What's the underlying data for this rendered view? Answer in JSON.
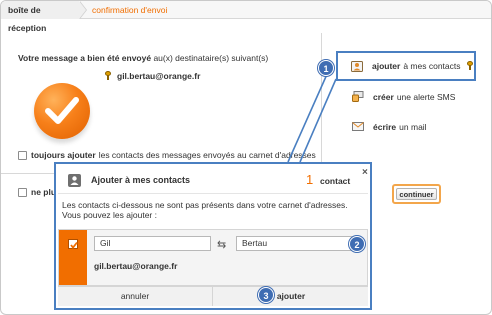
{
  "breadcrumb": {
    "items": [
      "boîte de réception",
      "confirmation d'envoi"
    ]
  },
  "confirmation": {
    "message_bold": "Votre message a bien été envoyé",
    "message_rest": "au(x) destinataire(s) suivant(s)",
    "recipient": "gil.bertau@orange.fr"
  },
  "options": {
    "always_add_bold": "toujours ajouter",
    "always_add_rest": "les contacts des messages envoyés au carnet d'adresses",
    "no_more_label": "ne plus"
  },
  "actions": [
    {
      "bold": "ajouter",
      "rest": "à mes contacts",
      "icon": "add-contact-icon"
    },
    {
      "bold": "créer",
      "rest": "une alerte SMS",
      "icon": "sms-icon"
    },
    {
      "bold": "écrire",
      "rest": "un mail",
      "icon": "mail-icon"
    }
  ],
  "continue_label": "continuer",
  "callouts": [
    "1",
    "2",
    "3"
  ],
  "dialog": {
    "title": "Ajouter à mes contacts",
    "count": "1",
    "count_label": "contact",
    "close_label": "×",
    "description": "Les contacts ci-dessous ne sont pas présents dans votre carnet d'adresses. Vous pouvez les ajouter :",
    "contact": {
      "first_name": "Gil",
      "last_name": "Bertau",
      "email": "gil.bertau@orange.fr"
    },
    "cancel_label": "annuler",
    "add_label": "ajouter"
  },
  "colors": {
    "accent_orange": "#f16e00",
    "callout_blue": "#3f6db3",
    "highlight_border": "#4a7fc1"
  }
}
